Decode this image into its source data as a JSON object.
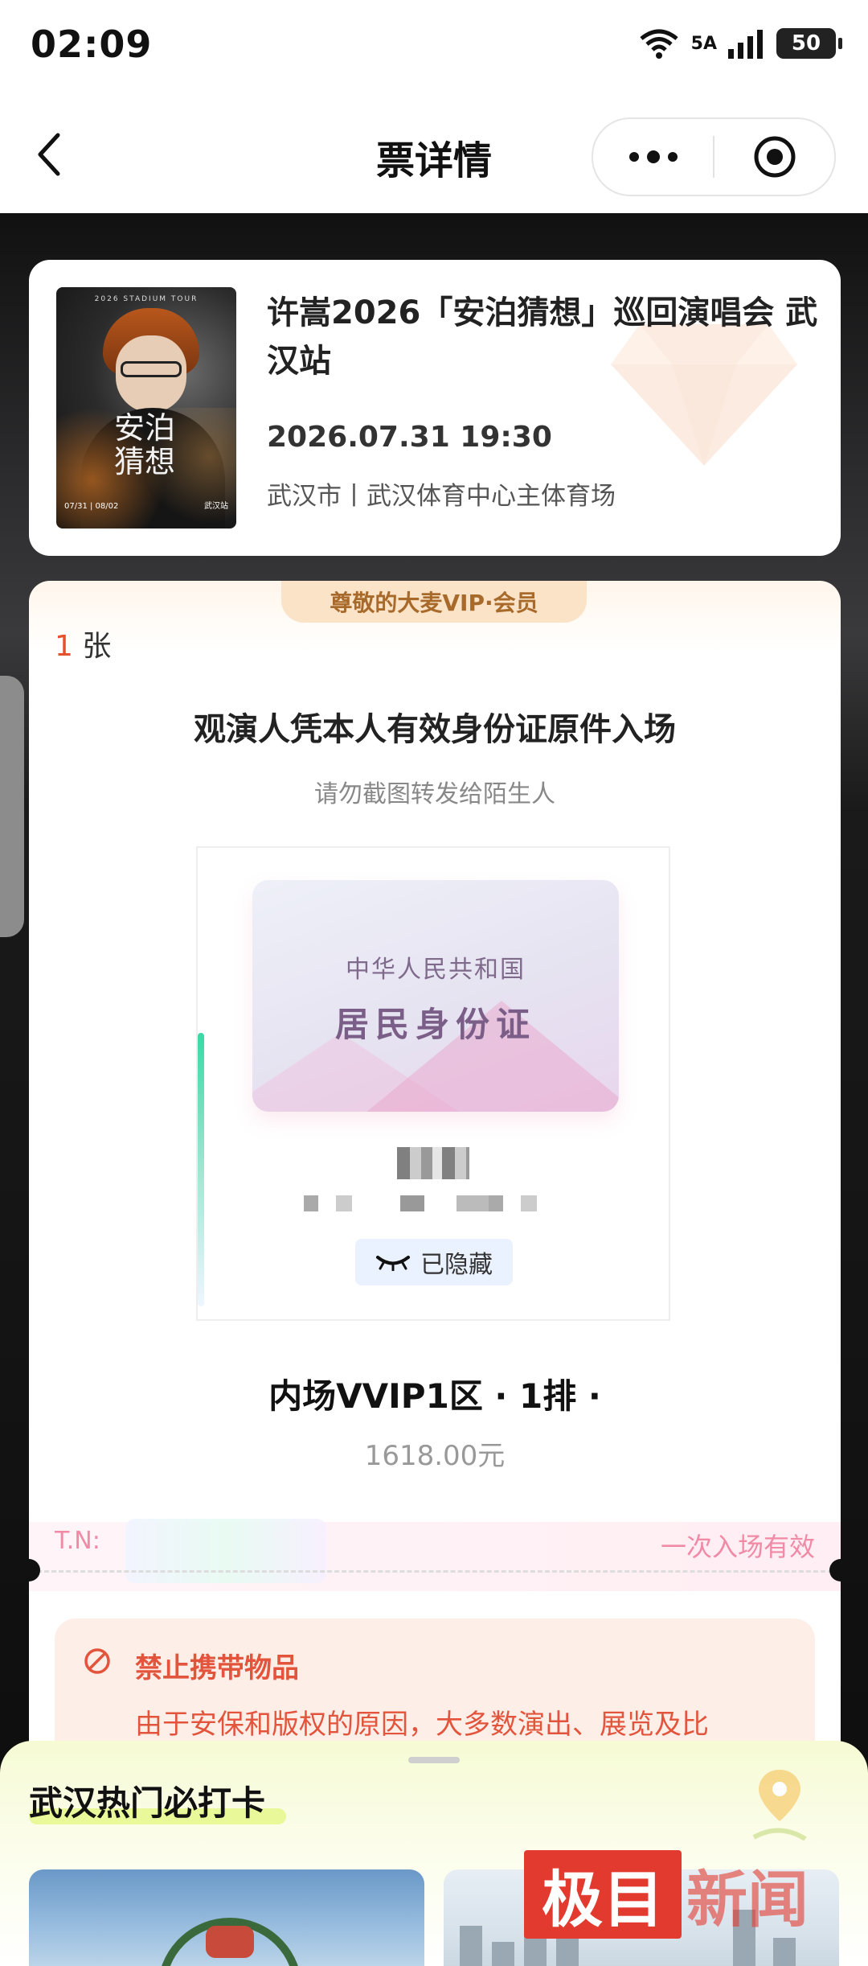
{
  "status_bar": {
    "time": "02:09",
    "network": "5A",
    "battery": "50"
  },
  "nav": {
    "title": "票详情"
  },
  "event": {
    "poster_title": "安泊猜想",
    "poster_tour": "2026 STADIUM TOUR",
    "poster_dates": "07/31 | 08/02",
    "poster_city": "武汉站",
    "title": "许嵩2026「安泊猜想」巡回演唱会 武汉站",
    "datetime": "2026.07.31 19:30",
    "venue": "武汉市丨武汉体育中心主体育场"
  },
  "ticket": {
    "vip_badge": "尊敬的大麦VIP·会员",
    "count_num": "1",
    "count_unit": "张",
    "entry_title": "观演人凭本人有效身份证原件入场",
    "entry_sub": "请勿截图转发给陌生人",
    "id_card_line1": "中华人民共和国",
    "id_card_line2": "居民身份证",
    "hidden_label": "已隐藏",
    "seat": "内场VVIP1区 · 1排 ·",
    "price": "1618.00元",
    "tn_label": "T.N:",
    "entry_rule": "一次入场有效"
  },
  "notice": {
    "title": "禁止携带物品",
    "body": "由于安保和版权的原因，大多数演出、展览及比"
  },
  "sheet": {
    "title": "武汉热门必打卡"
  },
  "watermark": {
    "box": "极目",
    "text": "新闻"
  }
}
